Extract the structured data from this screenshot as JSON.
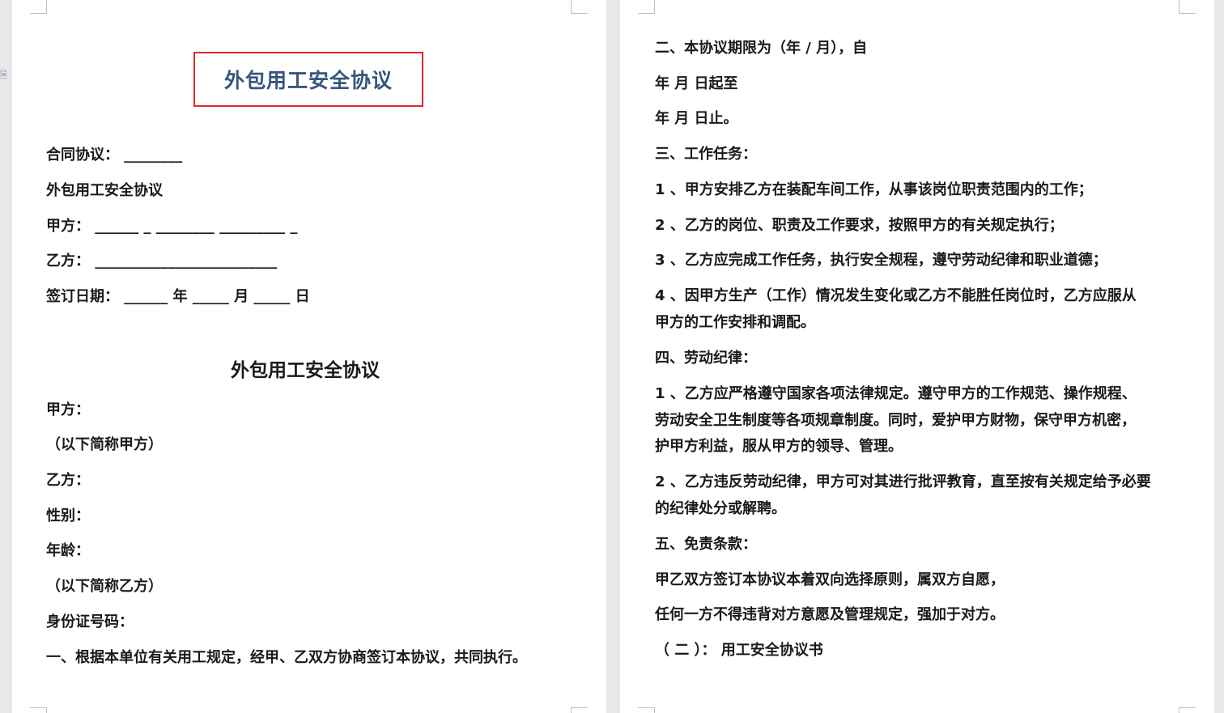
{
  "left_page": {
    "title": "外包用工安全协议",
    "contract": "合同协议：  ________",
    "doc_name": "外包用工安全协议",
    "party_a_blank": "甲方：   ______ _ ________ _________ _",
    "party_b_blank": "乙方：   _________________________",
    "sign_date": "签订日期：  ______ 年 _____ 月 _____ 日",
    "heading": "外包用工安全协议",
    "party_a": "甲方：",
    "party_a_short": "（以下简称甲方）",
    "party_b": "乙方：",
    "gender": "性别：",
    "age": "年龄：",
    "party_b_short": "（以下简称乙方）",
    "id_number": "身份证号码：",
    "clause_1": "一、根据本单位有关用工规定，经甲、乙双方协商签订本协议，共同执行。"
  },
  "right_page": {
    "term_1": "二、本协议期限为（年 / 月），自",
    "term_2": "年   月   日起至",
    "term_3": "年   月   日止。",
    "tasks_heading": "三、工作任务：",
    "task_1": "1 、甲方安排乙方在装配车间工作，从事该岗位职责范围内的工作；",
    "task_2": "2 、乙方的岗位、职责及工作要求，按照甲方的有关规定执行；",
    "task_3": "3 、乙方应完成工作任务，执行安全规程，遵守劳动纪律和职业道德；",
    "task_4a": "4 、因甲方生产（工作）情况发生变化或乙方不能胜任岗位时，乙方应服从",
    "task_4b": "甲方的工作安排和调配。",
    "discipline_heading": "四、劳动纪律：",
    "disc_1a": "1 、乙方应严格遵守国家各项法律规定。遵守甲方的工作规范、操作规程、",
    "disc_1b": "劳动安全卫生制度等各项规章制度。同时，爱护甲方财物，保守甲方机密，",
    "disc_1c": "护甲方利益，服从甲方的领导、管理。",
    "disc_2a": "2 、乙方违反劳动纪律，甲方可对其进行批评教育，直至按有关规定给予必要",
    "disc_2b": "的纪律处分或解聘。",
    "exempt_heading": "五、免责条款：",
    "exempt_1": "甲乙双方签订本协议本着双向选择原则，属双方自愿，",
    "exempt_2": "任何一方不得违背对方意愿及管理规定，强加于对方。",
    "section_2": "（ 二 ）：  用工安全协议书"
  },
  "icons": {
    "side": "document-icon"
  },
  "colors": {
    "title": "#35557f",
    "title_border": "#e0282c"
  }
}
